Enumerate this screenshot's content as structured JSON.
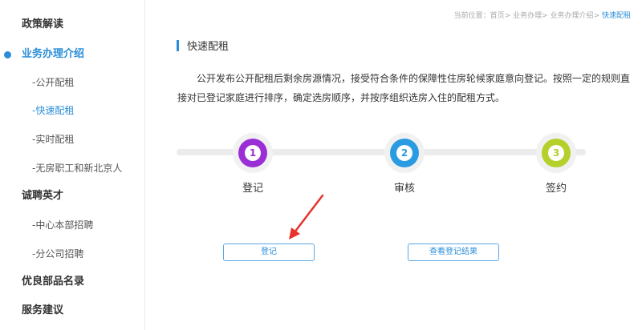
{
  "sidebar": {
    "items": [
      {
        "label": "政策解读",
        "level": "top",
        "active": false
      },
      {
        "label": "业务办理介绍",
        "level": "top",
        "active": true
      },
      {
        "label": "-公开配租",
        "level": "sub",
        "active": false
      },
      {
        "label": "-快速配租",
        "level": "sub",
        "active": true
      },
      {
        "label": "-实时配租",
        "level": "sub",
        "active": false
      },
      {
        "label": "-无房职工和新北京人",
        "level": "sub",
        "active": false
      },
      {
        "label": "诚聘英才",
        "level": "top",
        "active": false
      },
      {
        "label": "-中心本部招聘",
        "level": "sub",
        "active": false
      },
      {
        "label": "-分公司招聘",
        "level": "sub",
        "active": false
      },
      {
        "label": "优良部品名录",
        "level": "top",
        "active": false
      },
      {
        "label": "服务建议",
        "level": "top",
        "active": false
      }
    ]
  },
  "breadcrumb": {
    "prefix": "当前位置：",
    "links": [
      "首页",
      "业务办理",
      "业务办理介绍"
    ],
    "separator": ">",
    "current": "快速配租"
  },
  "main": {
    "title": "快速配租",
    "description": "公开发布公开配租后剩余房源情况，接受符合条件的保障性住房轮候家庭意向登记。按照一定的规则直接对已登记家庭进行排序，确定选房顺序，并按序组织选房入住的配租方式。"
  },
  "steps": [
    {
      "number": "1",
      "label": "登记",
      "color": "#9a2fd6"
    },
    {
      "number": "2",
      "label": "审核",
      "color": "#2a9be0"
    },
    {
      "number": "3",
      "label": "签约",
      "color": "#b4d02a"
    }
  ],
  "buttons": {
    "register": "登记",
    "view_result": "查看登记结果"
  },
  "colors": {
    "accent": "#2b8fd8",
    "annotation_arrow": "#e8322c"
  }
}
